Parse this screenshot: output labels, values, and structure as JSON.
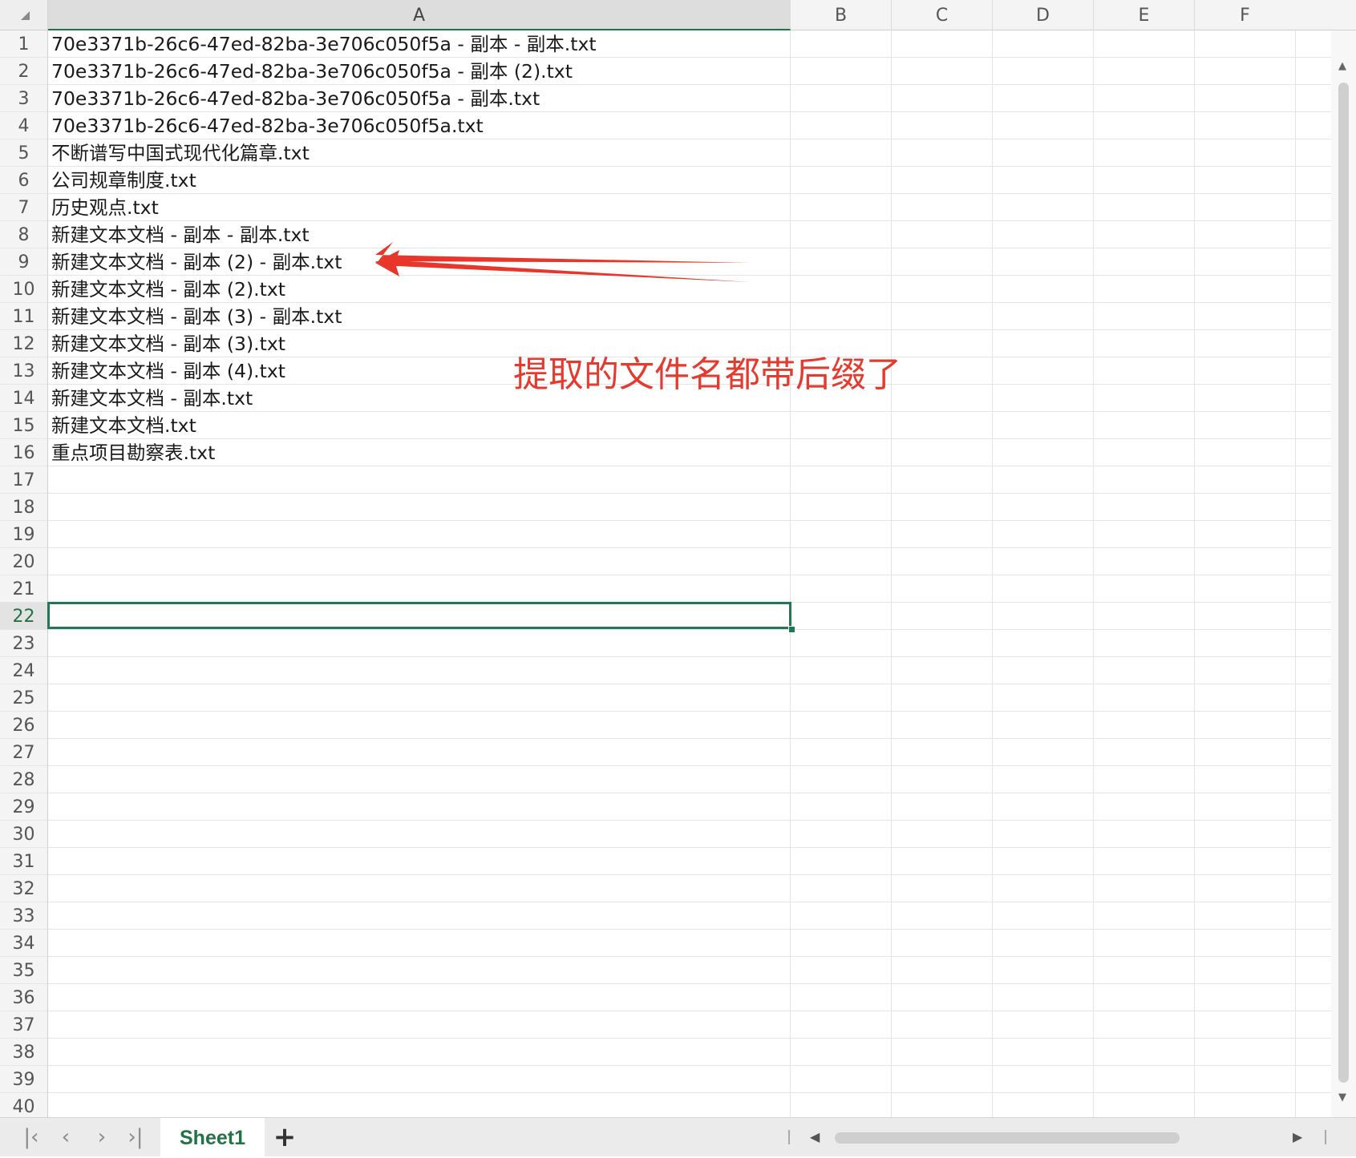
{
  "columns": [
    "A",
    "B",
    "C",
    "D",
    "E",
    "F"
  ],
  "selected_column": "A",
  "rows": [
    "1",
    "2",
    "3",
    "4",
    "5",
    "6",
    "7",
    "8",
    "9",
    "10",
    "11",
    "12",
    "13",
    "14",
    "15",
    "16",
    "17",
    "18",
    "19",
    "20",
    "21",
    "22",
    "23",
    "24",
    "25",
    "26",
    "27",
    "28",
    "29",
    "30",
    "31",
    "32",
    "33",
    "34",
    "35",
    "36",
    "37",
    "38",
    "39",
    "40"
  ],
  "selected_row": "22",
  "cells_a": [
    "70e3371b-26c6-47ed-82ba-3e706c050f5a - 副本 - 副本.txt",
    "70e3371b-26c6-47ed-82ba-3e706c050f5a - 副本 (2).txt",
    "70e3371b-26c6-47ed-82ba-3e706c050f5a - 副本.txt",
    "70e3371b-26c6-47ed-82ba-3e706c050f5a.txt",
    "不断谱写中国式现代化篇章.txt",
    "公司规章制度.txt",
    "历史观点.txt",
    "新建文本文档 - 副本 - 副本.txt",
    "新建文本文档 - 副本 (2) - 副本.txt",
    "新建文本文档 - 副本 (2).txt",
    "新建文本文档 - 副本 (3) - 副本.txt",
    "新建文本文档 - 副本 (3).txt",
    "新建文本文档 - 副本 (4).txt",
    "新建文本文档 - 副本.txt",
    "新建文本文档.txt",
    "重点项目勘察表.txt"
  ],
  "annotation": {
    "text": "提取的文件名都带后缀了",
    "color": "#e53a2e"
  },
  "sheet_tab": "Sheet1",
  "add_sheet_label": "+",
  "accent_color": "#217346"
}
